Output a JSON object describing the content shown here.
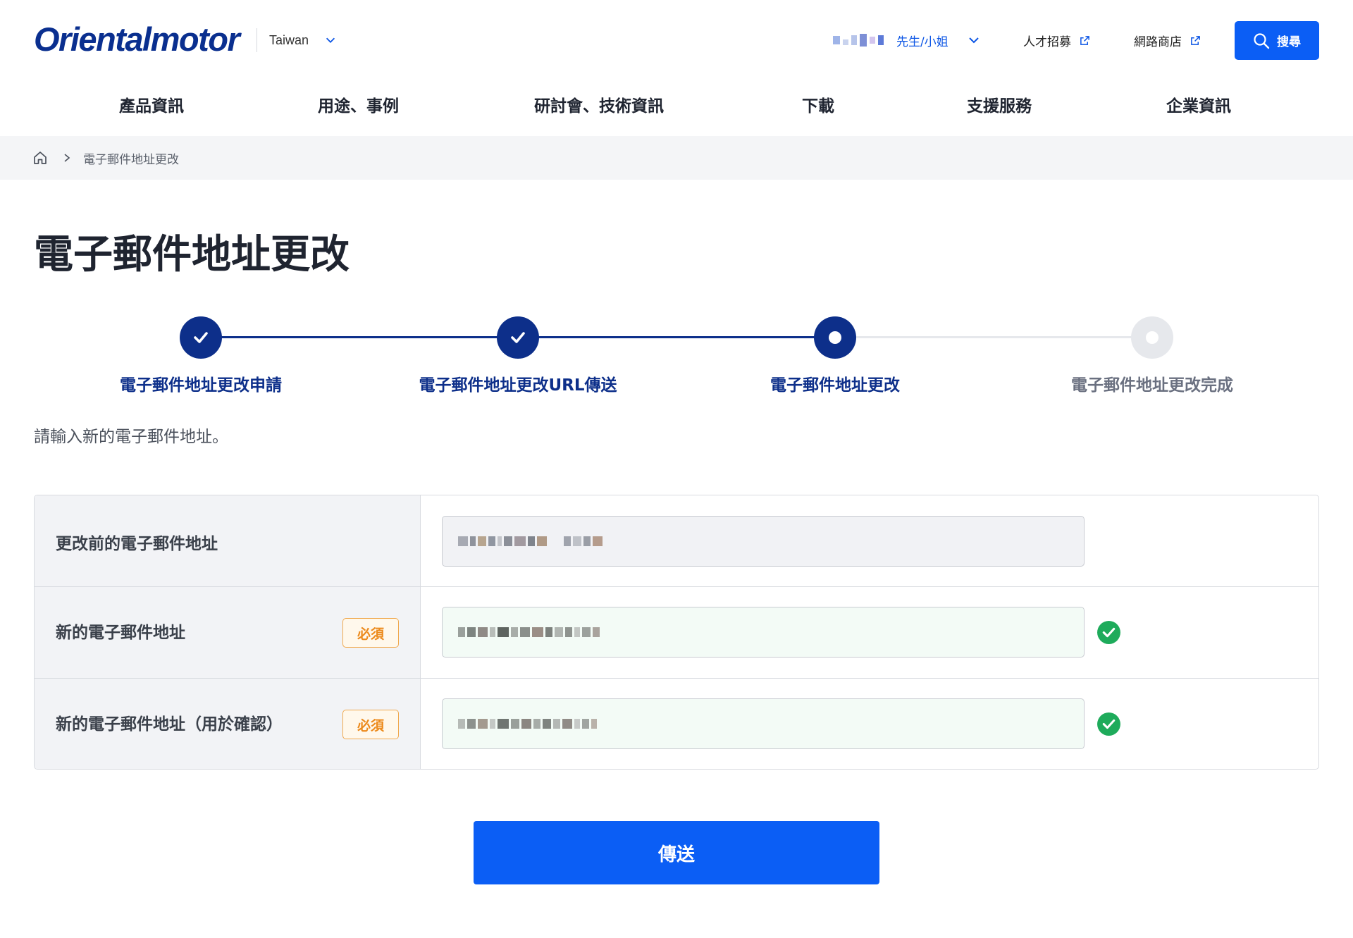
{
  "header": {
    "brand": "Orientalmotor",
    "region": "Taiwan",
    "user_suffix": "先生/小姐",
    "recruit_label": "人才招募",
    "shop_label": "網路商店",
    "search_label": "搜尋"
  },
  "nav": {
    "items": [
      {
        "label": "產品資訊"
      },
      {
        "label": "用途、事例"
      },
      {
        "label": "研討會、技術資訊"
      },
      {
        "label": "下載"
      },
      {
        "label": "支援服務"
      },
      {
        "label": "企業資訊"
      }
    ]
  },
  "breadcrumb": {
    "current": "電子郵件地址更改"
  },
  "page": {
    "title": "電子郵件地址更改",
    "lead": "請輸入新的電子郵件地址。"
  },
  "stepper": {
    "steps": [
      {
        "label": "電子郵件地址更改申請",
        "state": "done"
      },
      {
        "label": "電子郵件地址更改URL傳送",
        "state": "done"
      },
      {
        "label": "電子郵件地址更改",
        "state": "current"
      },
      {
        "label": "電子郵件地址更改完成",
        "state": "upcoming"
      }
    ],
    "active_color": "#0d2f8a",
    "inactive_color": "#e6e8ec"
  },
  "form": {
    "required_label": "必須",
    "rows": [
      {
        "label": "更改前的電子郵件地址",
        "required": false,
        "state": "readonly"
      },
      {
        "label": "新的電子郵件地址",
        "required": true,
        "state": "valid"
      },
      {
        "label": "新的電子郵件地址（用於確認）",
        "required": true,
        "state": "valid"
      }
    ]
  },
  "actions": {
    "submit_label": "傳送"
  },
  "colors": {
    "brand": "#0a2f8f",
    "primary_button": "#0b5ef5",
    "link_blue": "#0b55e5",
    "success": "#1eab5b",
    "required": "#ec8a1c"
  }
}
